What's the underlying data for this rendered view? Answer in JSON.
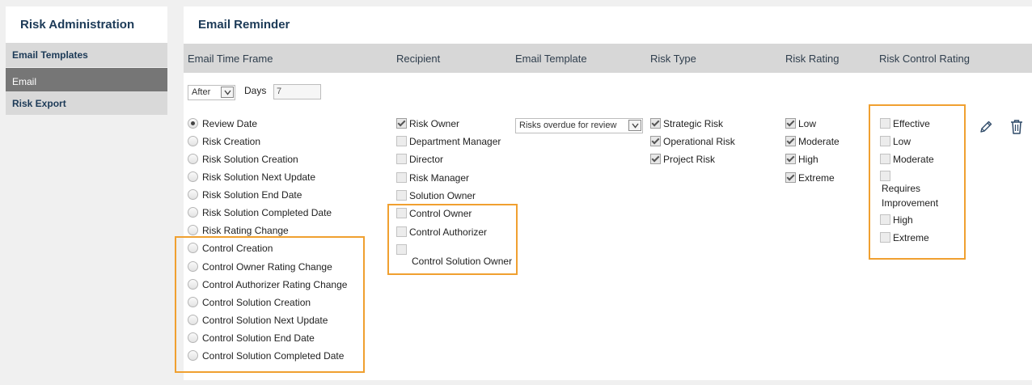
{
  "sidebar": {
    "title": "Risk Administration",
    "items": [
      {
        "label": "Email Templates",
        "active": false
      },
      {
        "label": "Email",
        "active": true
      },
      {
        "label": "Risk Export",
        "active": false
      }
    ]
  },
  "main": {
    "title": "Email Reminder",
    "columns": {
      "time_frame": "Email Time Frame",
      "recipient": "Recipient",
      "template": "Email Template",
      "risk_type": "Risk Type",
      "risk_rating": "Risk Rating",
      "control_rating": "Risk Control Rating"
    },
    "timing": {
      "select_value": "After",
      "days_label": "Days",
      "days_value": "7"
    },
    "time_frame_options": [
      {
        "label": "Review Date",
        "selected": true
      },
      {
        "label": "Risk Creation",
        "selected": false
      },
      {
        "label": "Risk Solution Creation",
        "selected": false
      },
      {
        "label": "Risk Solution Next Update",
        "selected": false
      },
      {
        "label": "Risk Solution End Date",
        "selected": false
      },
      {
        "label": "Risk Solution Completed Date",
        "selected": false
      },
      {
        "label": "Risk Rating Change",
        "selected": false
      },
      {
        "label": "Control Creation",
        "selected": false
      },
      {
        "label": "Control Owner Rating Change",
        "selected": false
      },
      {
        "label": "Control Authorizer Rating Change",
        "selected": false
      },
      {
        "label": "Control Solution Creation",
        "selected": false
      },
      {
        "label": "Control Solution Next Update",
        "selected": false
      },
      {
        "label": "Control Solution End Date",
        "selected": false
      },
      {
        "label": "Control Solution Completed Date",
        "selected": false
      }
    ],
    "recipients": [
      {
        "label": "Risk Owner",
        "checked": true
      },
      {
        "label": "Department Manager",
        "checked": false
      },
      {
        "label": "Director",
        "checked": false
      },
      {
        "label": "Risk Manager",
        "checked": false
      },
      {
        "label": "Solution Owner",
        "checked": false
      },
      {
        "label": "Control Owner",
        "checked": false
      },
      {
        "label": "Control Authorizer",
        "checked": false
      },
      {
        "label": "Control Solution Owner",
        "checked": false
      }
    ],
    "template_select": "Risks overdue for review",
    "risk_types": [
      {
        "label": "Strategic Risk",
        "checked": true
      },
      {
        "label": "Operational Risk",
        "checked": true
      },
      {
        "label": "Project Risk",
        "checked": true
      }
    ],
    "risk_ratings": [
      {
        "label": "Low",
        "checked": true
      },
      {
        "label": "Moderate",
        "checked": true
      },
      {
        "label": "High",
        "checked": true
      },
      {
        "label": "Extreme",
        "checked": true
      }
    ],
    "control_ratings": [
      {
        "label": "Effective",
        "checked": false
      },
      {
        "label": "Low",
        "checked": false
      },
      {
        "label": "Moderate",
        "checked": false
      },
      {
        "label": "Requires Improvement",
        "line1": "Requires",
        "line2": "Improvement",
        "checked": false
      },
      {
        "label": "High",
        "checked": false
      },
      {
        "label": "Extreme",
        "checked": false
      }
    ],
    "actions": {
      "edit_icon": "pencil-icon",
      "delete_icon": "trash-icon"
    },
    "highlight_color": "#f0a030"
  }
}
